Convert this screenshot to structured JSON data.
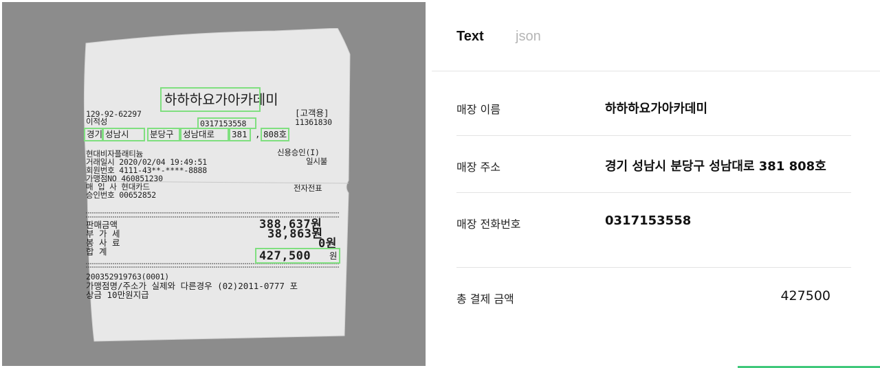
{
  "tabs": [
    {
      "label": "Text"
    },
    {
      "label": "json"
    }
  ],
  "results": {
    "store_name": {
      "label": "매장 이름",
      "value": "하하하요가아카데미"
    },
    "store_address": {
      "label": "매장 주소",
      "value": "경기 성남시 분당구 성남대로 381 808호"
    },
    "store_phone": {
      "label": "매장 전화번호",
      "value": "0317153558"
    },
    "total_amount": {
      "label": "총 결제 금액",
      "value": "427500"
    }
  },
  "receipt": {
    "store_name": "하하하요가아카데미",
    "business_no": "129-92-62297",
    "copy_type": "[고객용]",
    "owner": "이적성",
    "phone": "0317153558",
    "code": "11361830",
    "addr_city": "경기",
    "addr_si": "성남시",
    "addr_gu": "분당구",
    "addr_road": "성남대로",
    "addr_no": "381",
    "addr_sep": ",",
    "addr_unit": "808호",
    "card_product": "현대비자플래티늄",
    "approval_type": "신용승인(I)",
    "txn_datetime": "거래일시 2020/02/04 19:49:51",
    "installment": "일시불",
    "member_no": "회원번호 4111-43**-****-8888",
    "merchant_no": "가맹점NO 460851230",
    "issuer": "매 입 사 현대카드",
    "slip_type": "전자전표",
    "approval_no": "승인번호 00652852",
    "sale_label": "판매금액",
    "sale_amount": "388,637원",
    "vat_label": "부 가 세",
    "vat_amount": "38,863원",
    "fee_label": "봉 사 료",
    "fee_amount": "0원",
    "total_label": "합    계",
    "total_amount": "427,500",
    "total_unit": "원",
    "footer1": "200352919763(0001)",
    "footer2": "가맹점명/주소가 실제와 다른경우 (02)2011-0777 포",
    "footer3": "상금 10만원지급"
  },
  "colors": {
    "highlight": "#7fdf7f",
    "accent": "#3fc87a",
    "image_background": "#8c8c8c"
  }
}
